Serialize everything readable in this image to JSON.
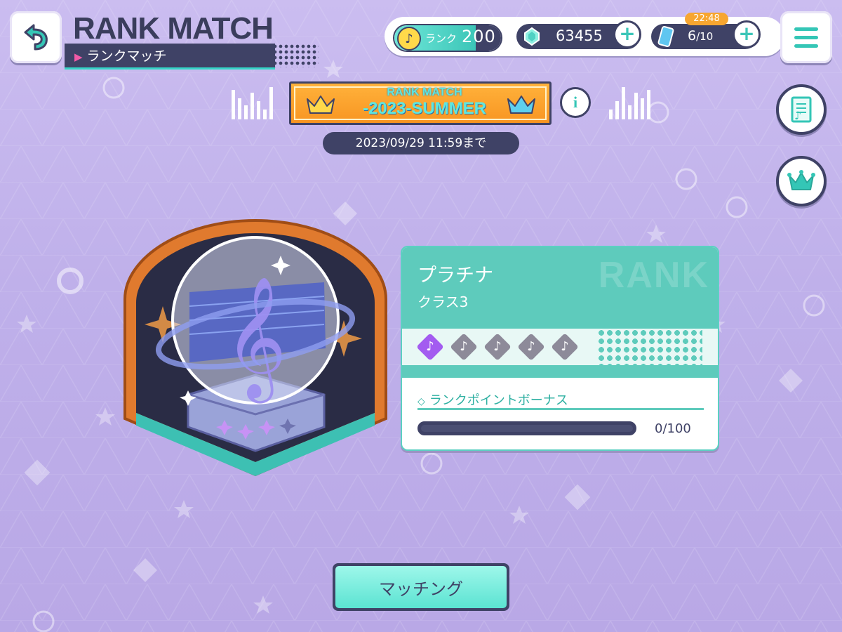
{
  "header": {
    "title": "RANK MATCH",
    "subtitle": "ランクマッチ"
  },
  "status": {
    "rank_label": "ランク",
    "rank_value": "200",
    "gems": "63455",
    "tickets_current": "6",
    "tickets_max": "/10",
    "timer": "22:48"
  },
  "event": {
    "banner_line1": "RANK MATCH",
    "banner_line2": "-2023-SUMMER",
    "deadline": "2023/09/29 11:59まで"
  },
  "rank_card": {
    "tier": "プラチナ",
    "class": "クラス3",
    "watermark": "RANK",
    "class_steps_total": 5,
    "class_steps_active": 1,
    "bonus_label": "ランクポイントボーナス",
    "progress_text": "0/100",
    "progress_fraction": 0
  },
  "actions": {
    "matching": "マッチング"
  },
  "colors": {
    "accent": "#34c6b6",
    "dark": "#3f4266",
    "background": "#c4b6ec",
    "active_step": "#a35cf0"
  },
  "icons": {
    "back": "back-arrow-icon",
    "menu": "hamburger-menu-icon",
    "rules": "music-sheet-icon",
    "ranking": "crown-icon",
    "info": "info-icon"
  }
}
